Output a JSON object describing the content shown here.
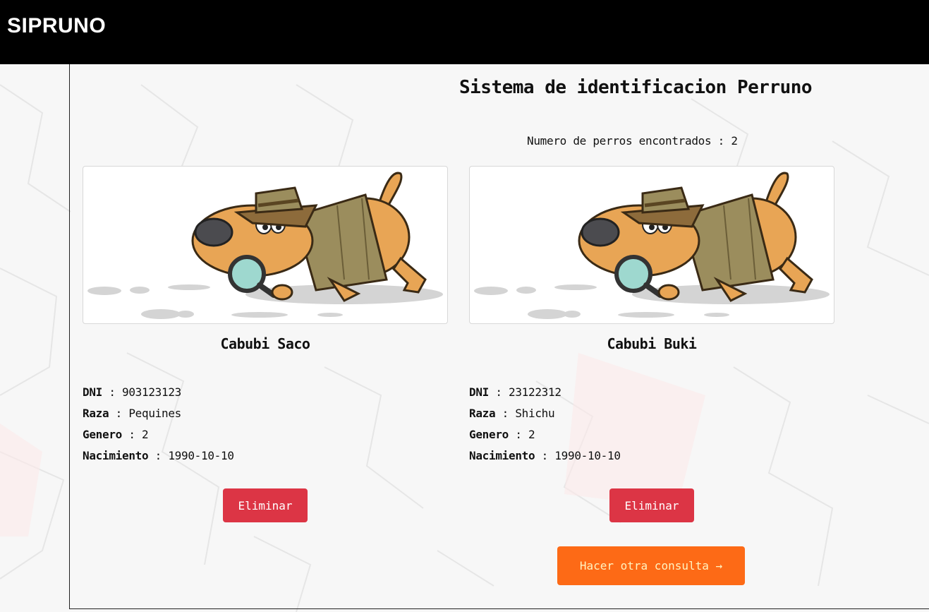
{
  "navbar": {
    "brand": "SIPRUNO"
  },
  "header": {
    "title": "Sistema de identificacion Perruno",
    "count_label": "Numero de perros encontrados",
    "count_sep": " : ",
    "count_value": "2"
  },
  "labels": {
    "dni": "DNI",
    "raza": "Raza",
    "genero": "Genero",
    "nacimiento": "Nacimiento",
    "sep": " : "
  },
  "dogs": [
    {
      "name": "Cabubi Saco",
      "dni": "903123123",
      "raza": "Pequines",
      "genero": "2",
      "nacimiento": "1990-10-10",
      "delete_label": "Eliminar"
    },
    {
      "name": "Cabubi Buki",
      "dni": "23122312",
      "raza": "Shichu",
      "genero": "2",
      "nacimiento": "1990-10-10",
      "delete_label": "Eliminar"
    }
  ],
  "actions": {
    "new_query_label": "Hacer otra consulta →"
  },
  "colors": {
    "navbar": "#000000",
    "delete": "#dc3545",
    "primary": "#fd6a16"
  },
  "icons": {
    "dog_image": "detective-dog-with-magnifier"
  }
}
